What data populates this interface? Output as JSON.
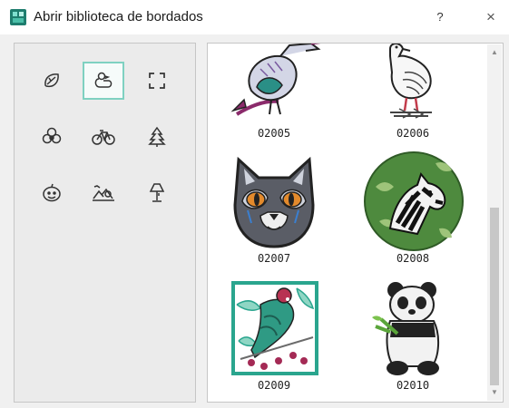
{
  "window": {
    "title": "Abrir biblioteca de bordados",
    "help_label": "?",
    "close_label": "×"
  },
  "categories": [
    {
      "icon": "leaf-icon",
      "selected": false
    },
    {
      "icon": "duck-icon",
      "selected": true
    },
    {
      "icon": "frame-corners-icon",
      "selected": false
    },
    {
      "icon": "flower-icon",
      "selected": false
    },
    {
      "icon": "bicycle-icon",
      "selected": false
    },
    {
      "icon": "christmas-tree-icon",
      "selected": false
    },
    {
      "icon": "pumpkin-icon",
      "selected": false
    },
    {
      "icon": "landscape-icon",
      "selected": false
    },
    {
      "icon": "lamp-icon",
      "selected": false
    }
  ],
  "designs": [
    {
      "code": "02005",
      "image": "bird-design"
    },
    {
      "code": "02006",
      "image": "seagull-design"
    },
    {
      "code": "02007",
      "image": "cat-face-design"
    },
    {
      "code": "02008",
      "image": "zebra-design"
    },
    {
      "code": "02009",
      "image": "parrot-frame-design"
    },
    {
      "code": "02010",
      "image": "panda-design"
    }
  ],
  "colors": {
    "accent": "#2aa58e",
    "selected_border": "#7fd1c1"
  }
}
